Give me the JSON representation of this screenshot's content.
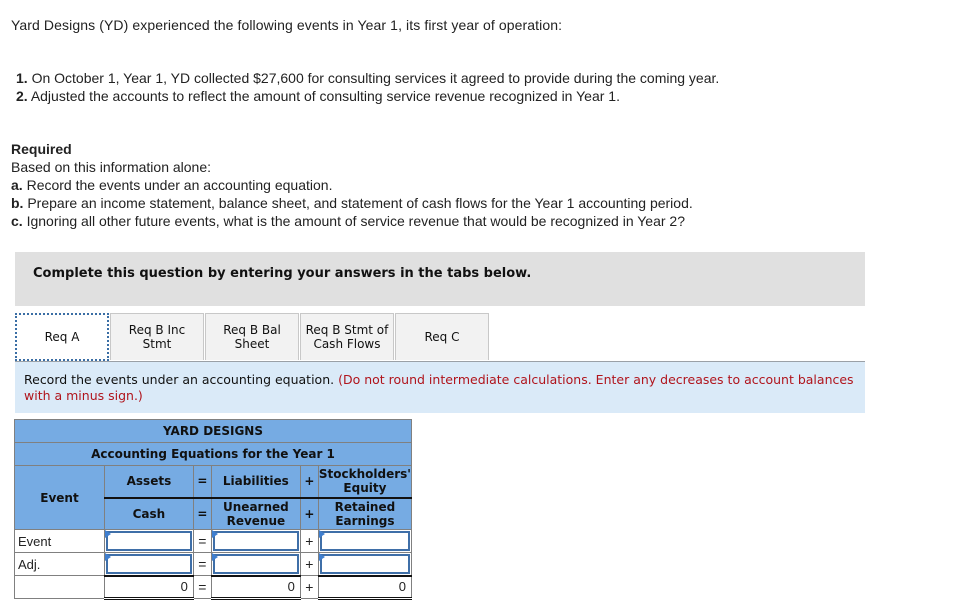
{
  "intro": "Yard Designs (YD) experienced the following events in Year 1, its first year of operation:",
  "events": [
    {
      "num": "1.",
      "text": "On October 1, Year 1, YD collected $27,600 for consulting services it agreed to provide during the coming year."
    },
    {
      "num": "2.",
      "text": "Adjusted the accounts to reflect the amount of consulting service revenue recognized in Year 1."
    }
  ],
  "required": {
    "title": "Required",
    "lead": "Based on this information alone:",
    "items": [
      {
        "letter": "a.",
        "text": "Record the events under an accounting equation."
      },
      {
        "letter": "b.",
        "text": "Prepare an income statement, balance sheet, and statement of cash flows for the Year 1 accounting period."
      },
      {
        "letter": "c.",
        "text": "Ignoring all other future events, what is the amount of service revenue that would be recognized in Year 2?"
      }
    ]
  },
  "banner": "Complete this question by entering your answers in the tabs below.",
  "tabs": [
    {
      "line1": "Req A",
      "line2": "",
      "active": true
    },
    {
      "line1": "Req B Inc",
      "line2": "Stmt",
      "active": false
    },
    {
      "line1": "Req B Bal",
      "line2": "Sheet",
      "active": false
    },
    {
      "line1": "Req B Stmt of",
      "line2": "Cash Flows",
      "active": false
    },
    {
      "line1": "Req C",
      "line2": "",
      "active": false
    }
  ],
  "instructions": {
    "main": "Record the events under an accounting equation.",
    "note": "(Do not round intermediate calculations. Enter any decreases to account balances with a minus sign.)"
  },
  "table": {
    "company": "YARD DESIGNS",
    "subtitle": "Accounting Equations for the Year 1",
    "event_header": "Event",
    "col_groups": {
      "assets": "Assets",
      "liabilities": "Liabilities",
      "equity": "Stockholders' Equity"
    },
    "columns": {
      "cash": "Cash",
      "unearned": "Unearned Revenue",
      "retained": "Retained Earnings"
    },
    "ops": {
      "eq": "=",
      "plus": "+"
    },
    "rows": [
      {
        "label": "Event",
        "cash": "",
        "unearned": "",
        "retained": ""
      },
      {
        "label": "Adj.",
        "cash": "",
        "unearned": "",
        "retained": ""
      }
    ],
    "totals": {
      "cash": "0",
      "unearned": "0",
      "retained": "0"
    }
  }
}
